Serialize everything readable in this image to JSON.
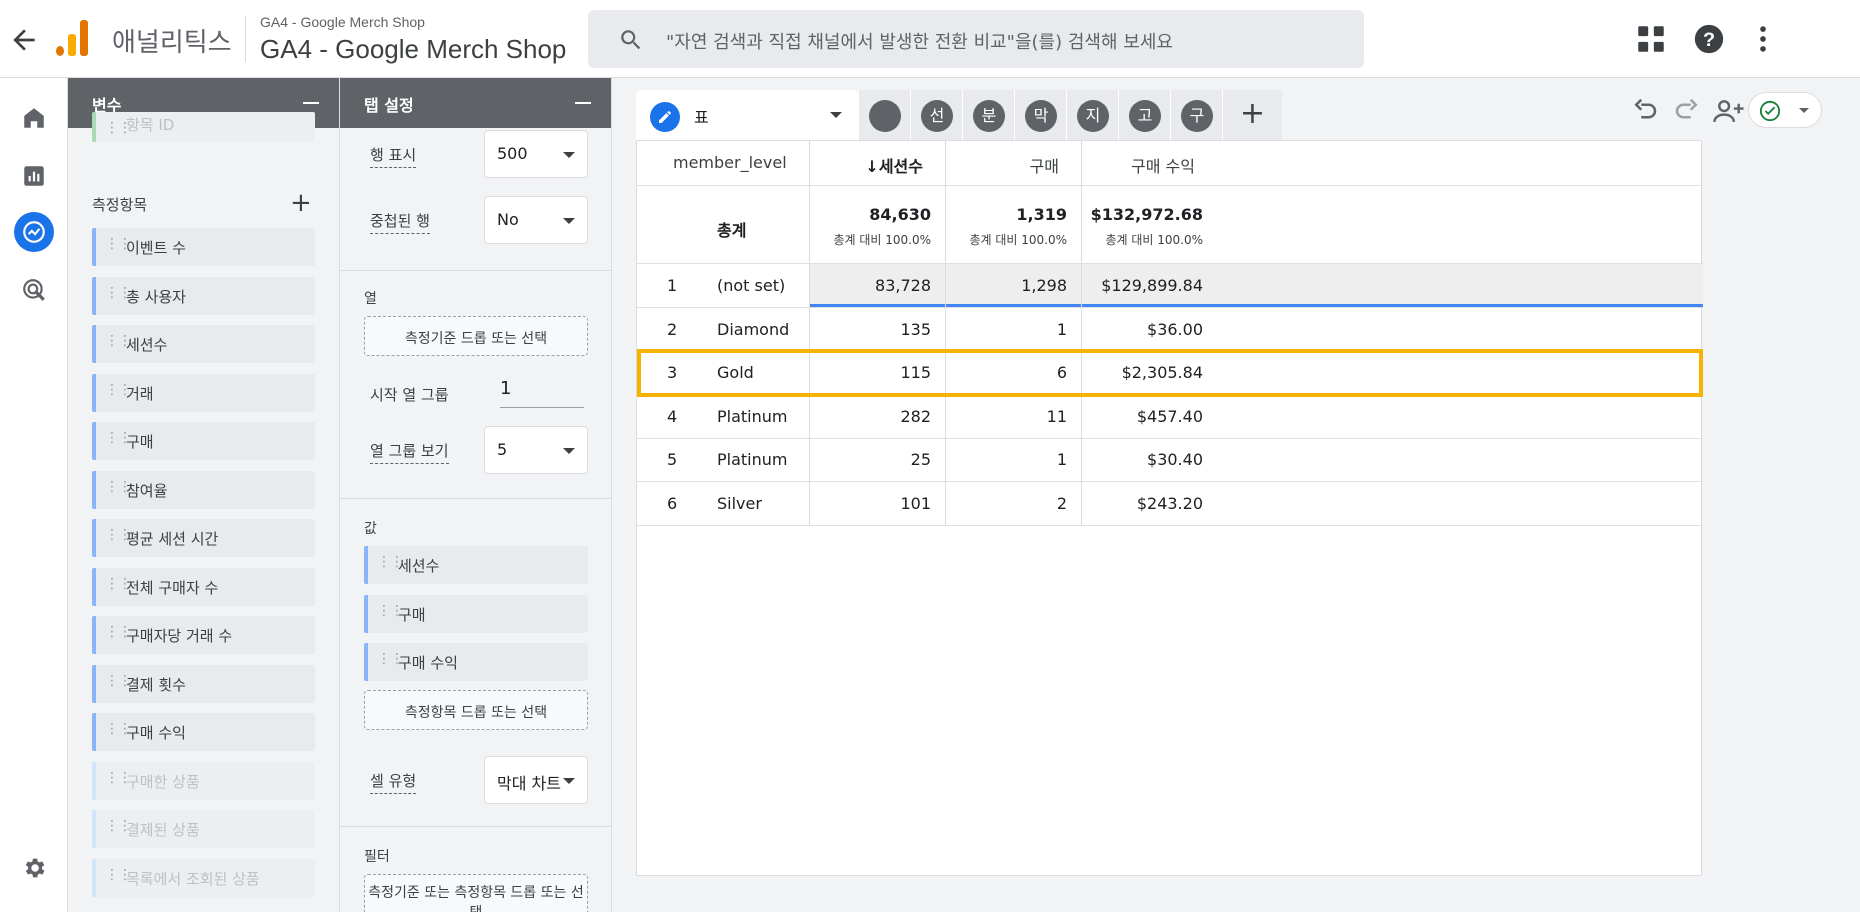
{
  "header": {
    "app_name": "애널리틱스",
    "property_small": "GA4 - Google Merch Shop",
    "property_name": "GA4 - Google Merch Shop",
    "search_placeholder": "\"자연 검색과 직접 채널에서 발생한 전환 비교\"을(를) 검색해 보세요",
    "icons": [
      "back-arrow-icon",
      "search-icon",
      "apps-grid-icon",
      "help-icon",
      "more-vert-icon"
    ]
  },
  "leftnav": {
    "icons": [
      "home-icon",
      "reports-icon",
      "explore-icon",
      "advertising-icon",
      "settings-icon"
    ]
  },
  "variables": {
    "title": "변수",
    "clipped_chip": "항목 ID",
    "metrics_label": "측정항목",
    "metrics": [
      "이벤트 수",
      "총 사용자",
      "세션수",
      "거래",
      "구매",
      "참여율",
      "평균 세션 시간",
      "전체 구매자 수",
      "구매자당 거래 수",
      "결제 횟수",
      "구매 수익"
    ],
    "metrics_faded": [
      "구매한 상품",
      "결제된 상품",
      "목록에서 조회된 상품"
    ]
  },
  "tab_settings": {
    "title": "탭 설정",
    "rows_label": "행 표시",
    "rows_value": "500",
    "nested_label": "중첩된 행",
    "nested_value": "No",
    "columns_label": "열",
    "columns_drop": "측정기준 드롭 또는 선택",
    "start_group_label": "시작 열 그룹",
    "start_group_value": "1",
    "show_groups_label": "열 그룹 보기",
    "show_groups_value": "5",
    "values_label": "값",
    "values": [
      "세션수",
      "구매",
      "구매 수익"
    ],
    "values_drop": "측정항목 드롭 또는 선택",
    "cell_type_label": "셀 유형",
    "cell_type_value": "막대 차트",
    "filter_label": "필터",
    "filter_drop": "측정기준 또는 측정항목 드롭 또는 선택"
  },
  "tabs": {
    "active_label": "표",
    "other_tabs": [
      "",
      "선",
      "분",
      "막",
      "지",
      "고",
      "구"
    ],
    "add_label": "+"
  },
  "table": {
    "headers": [
      "member_level",
      "↓세션수",
      "구매",
      "구매 수익"
    ],
    "total_label": "총계",
    "totals": [
      {
        "value": "84,630",
        "sub": "총계 대비 100.0%"
      },
      {
        "value": "1,319",
        "sub": "총계 대비 100.0%"
      },
      {
        "value": "$132,972.68",
        "sub": "총계 대비 100.0%"
      }
    ],
    "rows": [
      {
        "idx": "1",
        "level": "(not set)",
        "sessions": "83,728",
        "purchases": "1,298",
        "revenue": "$129,899.84"
      },
      {
        "idx": "2",
        "level": "Diamond",
        "sessions": "135",
        "purchases": "1",
        "revenue": "$36.00"
      },
      {
        "idx": "3",
        "level": "Gold",
        "sessions": "115",
        "purchases": "6",
        "revenue": "$2,305.84"
      },
      {
        "idx": "4",
        "level": "Platinum",
        "sessions": "282",
        "purchases": "11",
        "revenue": "$457.40"
      },
      {
        "idx": "5",
        "level": "Platinum",
        "sessions": "25",
        "purchases": "1",
        "revenue": "$30.40"
      },
      {
        "idx": "6",
        "level": "Silver",
        "sessions": "101",
        "purchases": "2",
        "revenue": "$243.20"
      }
    ],
    "highlighted_row": "3"
  },
  "colors": {
    "accent": "#1a73e8",
    "highlight": "#f6b400",
    "panel_header": "#5f6368"
  }
}
